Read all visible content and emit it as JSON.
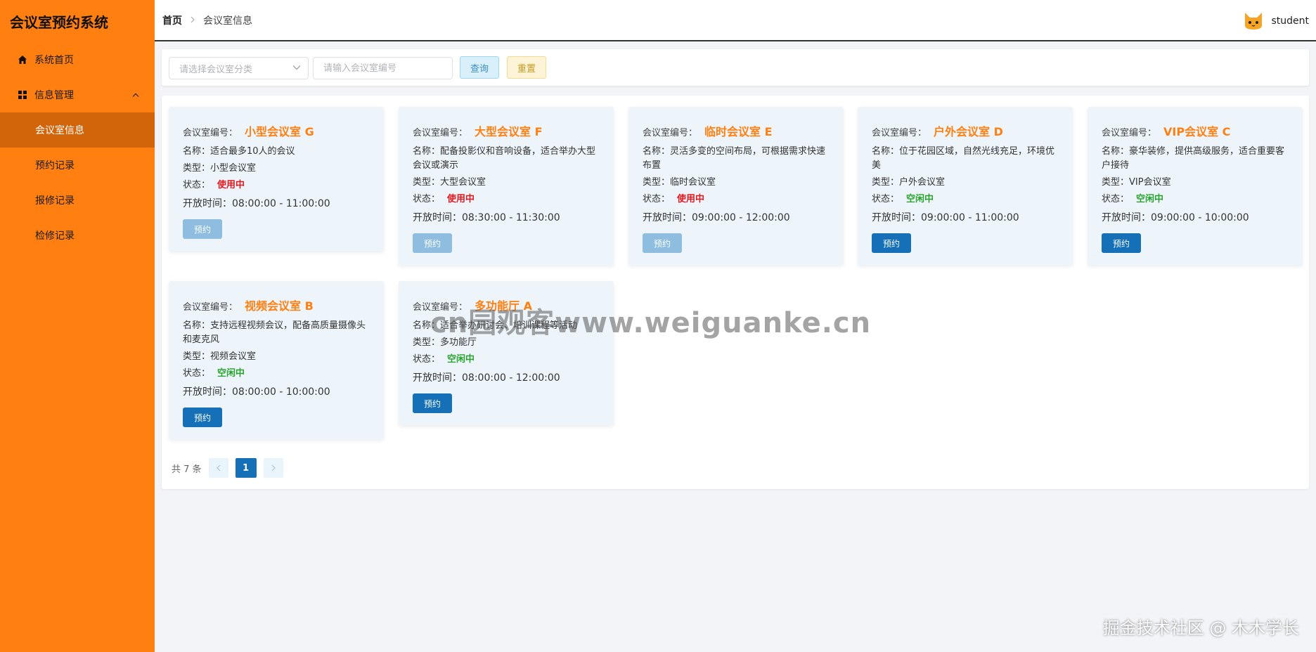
{
  "app": {
    "title": "会议室预约系统"
  },
  "sidebar": {
    "items": [
      {
        "label": "系统首页",
        "icon": "home-icon"
      },
      {
        "label": "信息管理",
        "icon": "grid-icon",
        "expanded": true
      }
    ],
    "submenu": [
      {
        "label": "会议室信息",
        "active": true
      },
      {
        "label": "预约记录"
      },
      {
        "label": "报修记录"
      },
      {
        "label": "检修记录"
      }
    ]
  },
  "header": {
    "breadcrumb": [
      "首页",
      "会议室信息"
    ],
    "user": "student"
  },
  "search": {
    "category_placeholder": "请选择会议室分类",
    "code_placeholder": "请输入会议室编号",
    "query_label": "查询",
    "reset_label": "重置"
  },
  "labels": {
    "code": "会议室编号：",
    "name": "名称：",
    "type": "类型：",
    "status": "状态：",
    "hours": "开放时间：",
    "book": "预约"
  },
  "rooms": [
    {
      "title": "小型会议室 G",
      "name": "适合最多10人的会议",
      "type": "小型会议室",
      "status": "使用中",
      "hours": "08:00:00 - 11:00:00",
      "available": false
    },
    {
      "title": "大型会议室 F",
      "name": "配备投影仪和音响设备，适合举办大型会议或演示",
      "type": "大型会议室",
      "status": "使用中",
      "hours": "08:30:00 - 11:30:00",
      "available": false
    },
    {
      "title": "临时会议室 E",
      "name": "灵活多变的空间布局，可根据需求快速布置",
      "type": "临时会议室",
      "status": "使用中",
      "hours": "09:00:00 - 12:00:00",
      "available": false
    },
    {
      "title": "户外会议室 D",
      "name": "位于花园区域，自然光线充足，环境优美",
      "type": "户外会议室",
      "status": "空闲中",
      "hours": "09:00:00 - 11:00:00",
      "available": true
    },
    {
      "title": "VIP会议室 C",
      "name": "豪华装修，提供高级服务，适合重要客户接待",
      "type": "VIP会议室",
      "status": "空闲中",
      "hours": "09:00:00 - 10:00:00",
      "available": true
    },
    {
      "title": "视频会议室 B",
      "name": "支持远程视频会议，配备高质量摄像头和麦克风",
      "type": "视频会议室",
      "status": "空闲中",
      "hours": "08:00:00 - 10:00:00",
      "available": true
    },
    {
      "title": "多功能厅 A",
      "name": "适合举办研讨会、培训课程等活动",
      "type": "多功能厅",
      "status": "空闲中",
      "hours": "08:00:00 - 12:00:00",
      "available": true
    }
  ],
  "pagination": {
    "total": "共 7 条",
    "current": "1"
  },
  "watermarks": {
    "center": "cn园观客www.weiguanke.cn",
    "corner": "掘金技术社区 @ 木木学长"
  },
  "colors": {
    "sidebar": "#ff7f11",
    "sidebar_active": "#d2650a",
    "accent": "#ff7f11",
    "primary": "#1570b7",
    "busy": "#e5181e",
    "free": "#2aa32e"
  }
}
